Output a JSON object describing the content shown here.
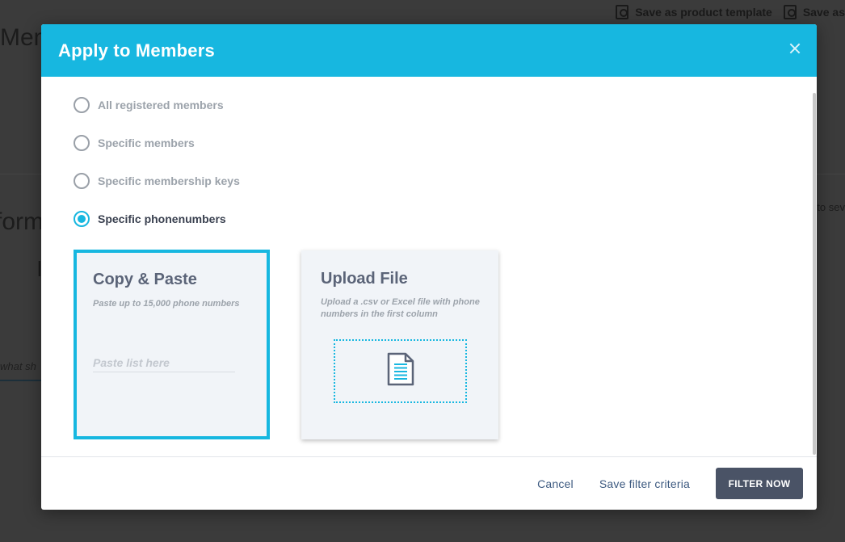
{
  "background": {
    "toolbar_actions": [
      {
        "label": "Save as product template"
      },
      {
        "label": "Save as"
      }
    ],
    "page_title_fragment": "Mem",
    "form_title_fragment": "form",
    "l_fragment": "l",
    "search_fragment": "what sh",
    "right_fragment": "to sev"
  },
  "modal": {
    "title": "Apply to Members",
    "close_icon": "close-icon",
    "options": [
      {
        "label": "All registered members",
        "checked": false
      },
      {
        "label": "Specific members",
        "checked": false
      },
      {
        "label": "Specific membership keys",
        "checked": false
      },
      {
        "label": "Specific phonenumbers",
        "checked": true
      }
    ],
    "copy_card": {
      "title": "Copy & Paste",
      "subtitle": "Paste up to 15,000 phone numbers",
      "placeholder": "Paste list here",
      "value": ""
    },
    "upload_card": {
      "title": "Upload File",
      "subtitle": "Upload a .csv or Excel file with phone numbers in the first column",
      "icon": "document-icon"
    },
    "footer": {
      "cancel_label": "Cancel",
      "save_label": "Save filter criteria",
      "filter_label": "FILTER NOW"
    }
  },
  "colors": {
    "accent": "#17b7e0",
    "primary_button": "#4a5366",
    "link": "#3d5a80"
  }
}
